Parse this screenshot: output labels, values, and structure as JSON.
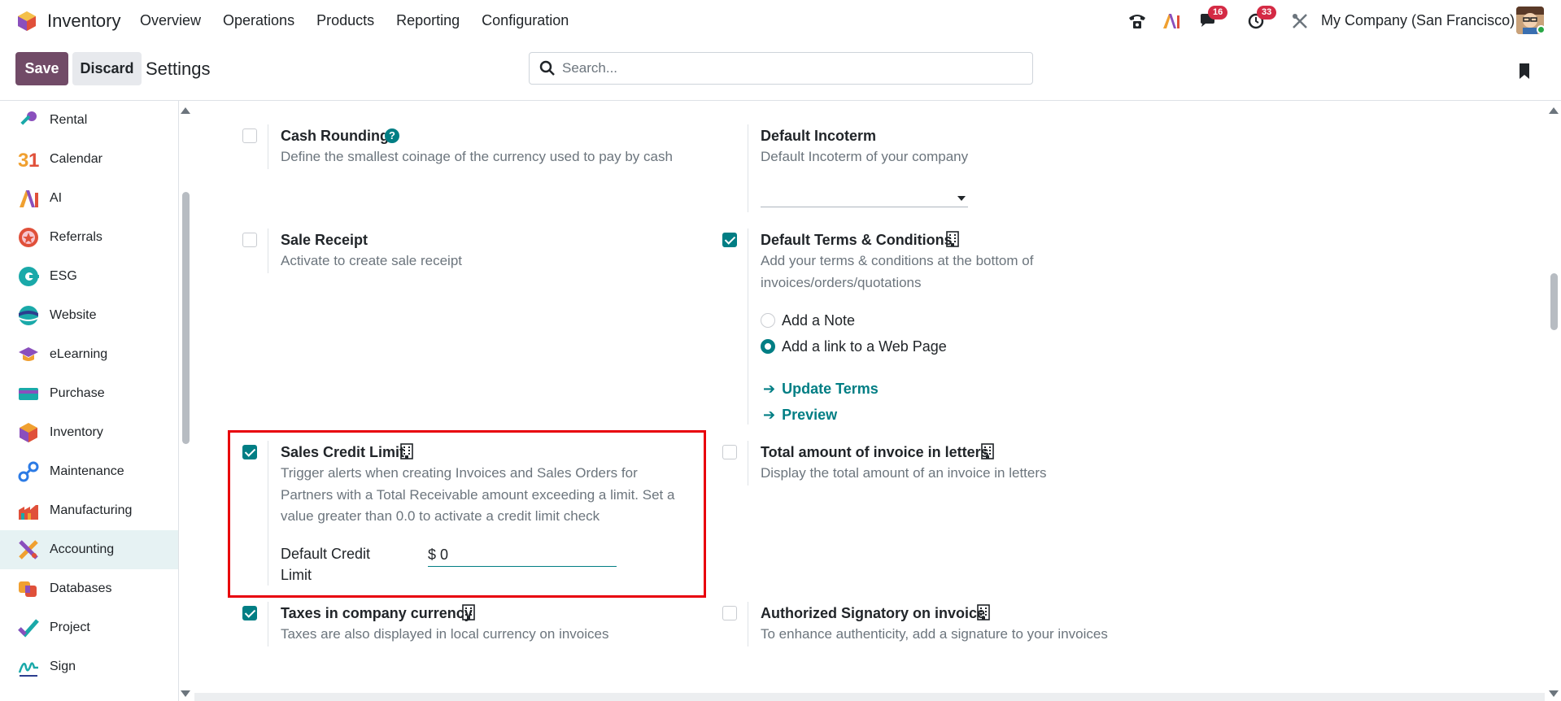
{
  "app": {
    "name": "Inventory",
    "brand_color": "#714b67",
    "accent_color": "#017e84"
  },
  "menu": [
    "Overview",
    "Operations",
    "Products",
    "Reporting",
    "Configuration"
  ],
  "systray": {
    "messages_count": "16",
    "activities_count": "33",
    "company": "My Company (San Francisco)"
  },
  "control": {
    "save_label": "Save",
    "discard_label": "Discard",
    "title": "Settings",
    "search_placeholder": "Search..."
  },
  "sidebar": {
    "items": [
      {
        "label": "Rental",
        "icon": "rental-icon"
      },
      {
        "label": "Calendar",
        "icon": "calendar-icon"
      },
      {
        "label": "AI",
        "icon": "ai-icon"
      },
      {
        "label": "Referrals",
        "icon": "referrals-icon"
      },
      {
        "label": "ESG",
        "icon": "esg-icon"
      },
      {
        "label": "Website",
        "icon": "website-icon"
      },
      {
        "label": "eLearning",
        "icon": "elearning-icon"
      },
      {
        "label": "Purchase",
        "icon": "purchase-icon"
      },
      {
        "label": "Inventory",
        "icon": "inventory-icon"
      },
      {
        "label": "Maintenance",
        "icon": "maintenance-icon"
      },
      {
        "label": "Manufacturing",
        "icon": "manufacturing-icon"
      },
      {
        "label": "Accounting",
        "icon": "accounting-icon",
        "active": true
      },
      {
        "label": "Databases",
        "icon": "databases-icon"
      },
      {
        "label": "Project",
        "icon": "project-icon"
      },
      {
        "label": "Sign",
        "icon": "sign-icon"
      }
    ]
  },
  "settings": {
    "cash_rounding": {
      "title": "Cash Rounding",
      "desc": "Define the smallest coinage of the currency used to pay by cash",
      "checked": false
    },
    "default_incoterm": {
      "title": "Default Incoterm",
      "desc": "Default Incoterm of your company",
      "value": ""
    },
    "sale_receipt": {
      "title": "Sale Receipt",
      "desc": "Activate to create sale receipt",
      "checked": false
    },
    "default_terms": {
      "title": "Default Terms & Conditions",
      "desc_line1": "Add your terms & conditions at the bottom of",
      "desc_line2": "invoices/orders/quotations",
      "checked": true,
      "options": [
        "Add a Note",
        "Add a link to a Web Page"
      ],
      "selected": "Add a link to a Web Page",
      "update_link": "Update Terms",
      "preview_link": "Preview"
    },
    "sales_credit_limit": {
      "title": "Sales Credit Limit",
      "desc_line1": "Trigger alerts when creating Invoices and Sales Orders for",
      "desc_line2": "Partners with a Total Receivable amount exceeding a limit. Set a",
      "desc_line3": "value greater than 0.0 to activate a credit limit check",
      "checked": true,
      "field_label_line1": "Default Credit",
      "field_label_line2": "Limit",
      "field_value": "$ 0"
    },
    "total_in_letters": {
      "title": "Total amount of invoice in letters",
      "desc": "Display the total amount of an invoice in letters",
      "checked": false
    },
    "taxes_company_currency": {
      "title": "Taxes in company currency",
      "desc": "Taxes are also displayed in local currency on invoices",
      "checked": true
    },
    "authorized_signatory": {
      "title": "Authorized Signatory on invoice",
      "desc": "To enhance authenticity, add a signature to your invoices",
      "checked": false
    }
  }
}
